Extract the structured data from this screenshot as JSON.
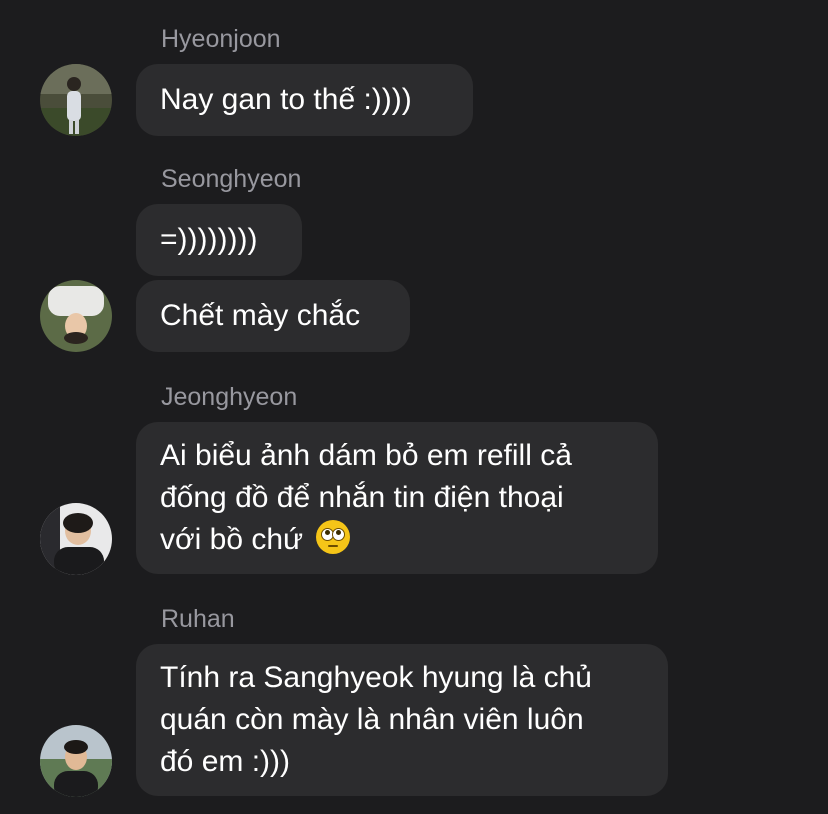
{
  "messages": [
    {
      "sender": "Hyeonjoon",
      "lines": [
        "Nay gan to thế :))))"
      ]
    },
    {
      "sender": "Seonghyeon",
      "bubbles": [
        {
          "lines": [
            "=))))))))"
          ]
        },
        {
          "lines": [
            "Chết mày chắc"
          ]
        }
      ]
    },
    {
      "sender": "Jeonghyeon",
      "lines": [
        "Ai biểu ảnh dám bỏ em refill cả",
        "đống đồ để nhắn tin điện thoại",
        "với bồ chứ"
      ],
      "emoji": "face-with-rolling-eyes-emoji"
    },
    {
      "sender": "Ruhan",
      "lines": [
        "Tính ra Sanghyeok hyung là chủ",
        "quán còn mày là nhân viên luôn",
        "đó em :)))"
      ]
    }
  ],
  "colors": {
    "background": "#1c1c1e",
    "bubble": "#2c2c2e",
    "sender_name": "#98989f",
    "text": "#ffffff"
  }
}
